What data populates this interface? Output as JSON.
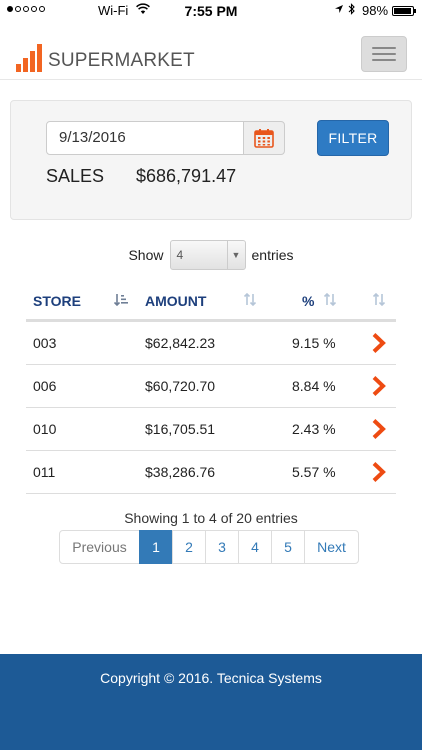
{
  "status_bar": {
    "carrier": "Wi-Fi",
    "time": "7:55 PM",
    "battery": "98%"
  },
  "navbar": {
    "brand": "SUPERMARKET",
    "brand_color": "#f26522"
  },
  "filter": {
    "date_value": "9/13/2016",
    "button_label": "FILTER",
    "sales_label": "SALES",
    "sales_value": "$686,791.47"
  },
  "length_menu": {
    "show_label": "Show",
    "selected": "4",
    "entries_label": "entries"
  },
  "table": {
    "columns": [
      "STORE",
      "AMOUNT",
      "%"
    ],
    "rows": [
      {
        "store": "003",
        "amount": "$62,842.23",
        "pct": "9.15 %"
      },
      {
        "store": "006",
        "amount": "$60,720.70",
        "pct": "8.84 %"
      },
      {
        "store": "010",
        "amount": "$16,705.51",
        "pct": "2.43 %"
      },
      {
        "store": "011",
        "amount": "$38,286.76",
        "pct": "5.57 %"
      }
    ]
  },
  "info": "Showing 1 to 4 of 20 entries",
  "pagination": {
    "previous": "Previous",
    "pages": [
      "1",
      "2",
      "3",
      "4",
      "5"
    ],
    "active": "1",
    "next": "Next"
  },
  "footer": {
    "copyright": "Copyright © 2016. Tecnica Systems"
  },
  "colors": {
    "accent": "#f26522",
    "primary": "#337ab7",
    "header_text": "#1d3f7c",
    "footer_bg": "#1d5a96"
  }
}
